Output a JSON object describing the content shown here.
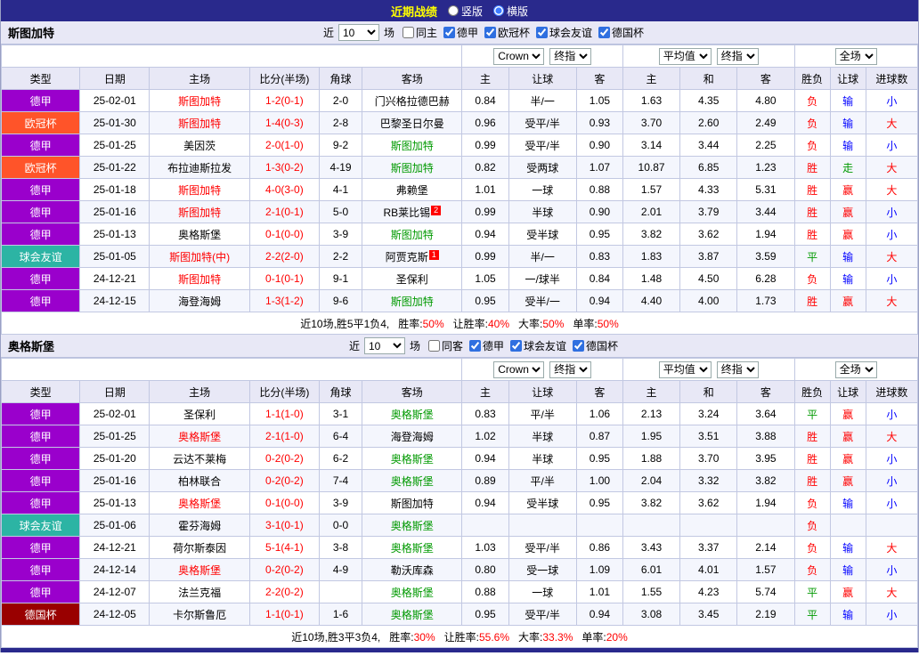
{
  "topbar": {
    "title": "近期战绩",
    "options": [
      {
        "label": "竖版",
        "selected": false
      },
      {
        "label": "横版",
        "selected": true
      }
    ]
  },
  "league_colors": {
    "德甲": "#9a00cc",
    "欧冠杯": "#ff5429",
    "球会友谊": "#2cb4a4",
    "德国杯": "#990000"
  },
  "text_colors": {
    "red": "#ff0000",
    "green": "#009900",
    "blue": "#0000ff",
    "black": "#000000"
  },
  "columns": [
    "类型",
    "日期",
    "主场",
    "比分(半场)",
    "角球",
    "客场",
    "主",
    "让球",
    "客",
    "主",
    "和",
    "客",
    "胜负",
    "让球",
    "进球数"
  ],
  "sections": [
    {
      "team": "斯图加特",
      "filter": {
        "near_label": "近",
        "count": "10",
        "unit_label": "场",
        "checkboxes": [
          {
            "label": "同主",
            "checked": false
          },
          {
            "label": "德甲",
            "checked": true
          },
          {
            "label": "欧冠杯",
            "checked": true
          },
          {
            "label": "球会友谊",
            "checked": true
          },
          {
            "label": "德国杯",
            "checked": true
          }
        ]
      },
      "selects": {
        "odds_source": "Crown",
        "odds_time": "终指",
        "europe_source": "平均值",
        "europe_time": "终指",
        "scope": "全场"
      },
      "rows": [
        {
          "league": "德甲",
          "date": "25-02-01",
          "home": {
            "text": "斯图加特",
            "color": "red"
          },
          "score": "1-2(0-1)",
          "corner": "2-0",
          "away": {
            "text": "门兴格拉德巴赫",
            "color": "black",
            "badge": ""
          },
          "asia": [
            "0.84",
            "半/一",
            "1.05"
          ],
          "europe": [
            "1.63",
            "4.35",
            "4.80"
          ],
          "result": {
            "text": "负",
            "color": "red"
          },
          "handicap": {
            "text": "输",
            "color": "blue"
          },
          "goals": {
            "text": "小",
            "color": "blue"
          }
        },
        {
          "league": "欧冠杯",
          "date": "25-01-30",
          "home": {
            "text": "斯图加特",
            "color": "red"
          },
          "score": "1-4(0-3)",
          "corner": "2-8",
          "away": {
            "text": "巴黎圣日尔曼",
            "color": "black",
            "badge": ""
          },
          "asia": [
            "0.96",
            "受平/半",
            "0.93"
          ],
          "europe": [
            "3.70",
            "2.60",
            "2.49"
          ],
          "result": {
            "text": "负",
            "color": "red"
          },
          "handicap": {
            "text": "输",
            "color": "blue"
          },
          "goals": {
            "text": "大",
            "color": "red"
          }
        },
        {
          "league": "德甲",
          "date": "25-01-25",
          "home": {
            "text": "美因茨",
            "color": "black"
          },
          "score": "2-0(1-0)",
          "corner": "9-2",
          "away": {
            "text": "斯图加特",
            "color": "green",
            "badge": ""
          },
          "asia": [
            "0.99",
            "受平/半",
            "0.90"
          ],
          "europe": [
            "3.14",
            "3.44",
            "2.25"
          ],
          "result": {
            "text": "负",
            "color": "red"
          },
          "handicap": {
            "text": "输",
            "color": "blue"
          },
          "goals": {
            "text": "小",
            "color": "blue"
          }
        },
        {
          "league": "欧冠杯",
          "date": "25-01-22",
          "home": {
            "text": "布拉迪斯拉发",
            "color": "black"
          },
          "score": "1-3(0-2)",
          "corner": "4-19",
          "away": {
            "text": "斯图加特",
            "color": "green",
            "badge": ""
          },
          "asia": [
            "0.82",
            "受两球",
            "1.07"
          ],
          "europe": [
            "10.87",
            "6.85",
            "1.23"
          ],
          "result": {
            "text": "胜",
            "color": "red"
          },
          "handicap": {
            "text": "走",
            "color": "green"
          },
          "goals": {
            "text": "大",
            "color": "red"
          }
        },
        {
          "league": "德甲",
          "date": "25-01-18",
          "home": {
            "text": "斯图加特",
            "color": "red"
          },
          "score": "4-0(3-0)",
          "corner": "4-1",
          "away": {
            "text": "弗赖堡",
            "color": "black",
            "badge": ""
          },
          "asia": [
            "1.01",
            "一球",
            "0.88"
          ],
          "europe": [
            "1.57",
            "4.33",
            "5.31"
          ],
          "result": {
            "text": "胜",
            "color": "red"
          },
          "handicap": {
            "text": "赢",
            "color": "red"
          },
          "goals": {
            "text": "大",
            "color": "red"
          }
        },
        {
          "league": "德甲",
          "date": "25-01-16",
          "home": {
            "text": "斯图加特",
            "color": "red"
          },
          "score": "2-1(0-1)",
          "corner": "5-0",
          "away": {
            "text": "RB莱比锡",
            "color": "black",
            "badge": "2"
          },
          "asia": [
            "0.99",
            "半球",
            "0.90"
          ],
          "europe": [
            "2.01",
            "3.79",
            "3.44"
          ],
          "result": {
            "text": "胜",
            "color": "red"
          },
          "handicap": {
            "text": "赢",
            "color": "red"
          },
          "goals": {
            "text": "小",
            "color": "blue"
          }
        },
        {
          "league": "德甲",
          "date": "25-01-13",
          "home": {
            "text": "奥格斯堡",
            "color": "black"
          },
          "score": "0-1(0-0)",
          "corner": "3-9",
          "away": {
            "text": "斯图加特",
            "color": "green",
            "badge": ""
          },
          "asia": [
            "0.94",
            "受半球",
            "0.95"
          ],
          "europe": [
            "3.82",
            "3.62",
            "1.94"
          ],
          "result": {
            "text": "胜",
            "color": "red"
          },
          "handicap": {
            "text": "赢",
            "color": "red"
          },
          "goals": {
            "text": "小",
            "color": "blue"
          }
        },
        {
          "league": "球会友谊",
          "date": "25-01-05",
          "home": {
            "text": "斯图加特(中)",
            "color": "red"
          },
          "score": "2-2(2-0)",
          "corner": "2-2",
          "away": {
            "text": "阿贾克斯",
            "color": "black",
            "badge": "1"
          },
          "asia": [
            "0.99",
            "半/一",
            "0.83"
          ],
          "europe": [
            "1.83",
            "3.87",
            "3.59"
          ],
          "result": {
            "text": "平",
            "color": "green"
          },
          "handicap": {
            "text": "输",
            "color": "blue"
          },
          "goals": {
            "text": "大",
            "color": "red"
          }
        },
        {
          "league": "德甲",
          "date": "24-12-21",
          "home": {
            "text": "斯图加特",
            "color": "red"
          },
          "score": "0-1(0-1)",
          "corner": "9-1",
          "away": {
            "text": "圣保利",
            "color": "black",
            "badge": ""
          },
          "asia": [
            "1.05",
            "一/球半",
            "0.84"
          ],
          "europe": [
            "1.48",
            "4.50",
            "6.28"
          ],
          "result": {
            "text": "负",
            "color": "red"
          },
          "handicap": {
            "text": "输",
            "color": "blue"
          },
          "goals": {
            "text": "小",
            "color": "blue"
          }
        },
        {
          "league": "德甲",
          "date": "24-12-15",
          "home": {
            "text": "海登海姆",
            "color": "black"
          },
          "score": "1-3(1-2)",
          "corner": "9-6",
          "away": {
            "text": "斯图加特",
            "color": "green",
            "badge": ""
          },
          "asia": [
            "0.95",
            "受半/一",
            "0.94"
          ],
          "europe": [
            "4.40",
            "4.00",
            "1.73"
          ],
          "result": {
            "text": "胜",
            "color": "red"
          },
          "handicap": {
            "text": "赢",
            "color": "red"
          },
          "goals": {
            "text": "大",
            "color": "red"
          }
        }
      ],
      "summary": {
        "prefix": "近10场,胜5平1负4,",
        "items": [
          {
            "label": "胜率:",
            "value": "50%"
          },
          {
            "label": "让胜率:",
            "value": "40%"
          },
          {
            "label": "大率:",
            "value": "50%"
          },
          {
            "label": "单率:",
            "value": "50%"
          }
        ]
      }
    },
    {
      "team": "奥格斯堡",
      "filter": {
        "near_label": "近",
        "count": "10",
        "unit_label": "场",
        "checkboxes": [
          {
            "label": "同客",
            "checked": false
          },
          {
            "label": "德甲",
            "checked": true
          },
          {
            "label": "球会友谊",
            "checked": true
          },
          {
            "label": "德国杯",
            "checked": true
          }
        ]
      },
      "selects": {
        "odds_source": "Crown",
        "odds_time": "终指",
        "europe_source": "平均值",
        "europe_time": "终指",
        "scope": "全场"
      },
      "rows": [
        {
          "league": "德甲",
          "date": "25-02-01",
          "home": {
            "text": "圣保利",
            "color": "black"
          },
          "score": "1-1(1-0)",
          "corner": "3-1",
          "away": {
            "text": "奥格斯堡",
            "color": "green",
            "badge": ""
          },
          "asia": [
            "0.83",
            "平/半",
            "1.06"
          ],
          "europe": [
            "2.13",
            "3.24",
            "3.64"
          ],
          "result": {
            "text": "平",
            "color": "green"
          },
          "handicap": {
            "text": "赢",
            "color": "red"
          },
          "goals": {
            "text": "小",
            "color": "blue"
          }
        },
        {
          "league": "德甲",
          "date": "25-01-25",
          "home": {
            "text": "奥格斯堡",
            "color": "red"
          },
          "score": "2-1(1-0)",
          "corner": "6-4",
          "away": {
            "text": "海登海姆",
            "color": "black",
            "badge": ""
          },
          "asia": [
            "1.02",
            "半球",
            "0.87"
          ],
          "europe": [
            "1.95",
            "3.51",
            "3.88"
          ],
          "result": {
            "text": "胜",
            "color": "red"
          },
          "handicap": {
            "text": "赢",
            "color": "red"
          },
          "goals": {
            "text": "大",
            "color": "red"
          }
        },
        {
          "league": "德甲",
          "date": "25-01-20",
          "home": {
            "text": "云达不莱梅",
            "color": "black"
          },
          "score": "0-2(0-2)",
          "corner": "6-2",
          "away": {
            "text": "奥格斯堡",
            "color": "green",
            "badge": ""
          },
          "asia": [
            "0.94",
            "半球",
            "0.95"
          ],
          "europe": [
            "1.88",
            "3.70",
            "3.95"
          ],
          "result": {
            "text": "胜",
            "color": "red"
          },
          "handicap": {
            "text": "赢",
            "color": "red"
          },
          "goals": {
            "text": "小",
            "color": "blue"
          }
        },
        {
          "league": "德甲",
          "date": "25-01-16",
          "home": {
            "text": "柏林联合",
            "color": "black"
          },
          "score": "0-2(0-2)",
          "corner": "7-4",
          "away": {
            "text": "奥格斯堡",
            "color": "green",
            "badge": ""
          },
          "asia": [
            "0.89",
            "平/半",
            "1.00"
          ],
          "europe": [
            "2.04",
            "3.32",
            "3.82"
          ],
          "result": {
            "text": "胜",
            "color": "red"
          },
          "handicap": {
            "text": "赢",
            "color": "red"
          },
          "goals": {
            "text": "小",
            "color": "blue"
          }
        },
        {
          "league": "德甲",
          "date": "25-01-13",
          "home": {
            "text": "奥格斯堡",
            "color": "red"
          },
          "score": "0-1(0-0)",
          "corner": "3-9",
          "away": {
            "text": "斯图加特",
            "color": "black",
            "badge": ""
          },
          "asia": [
            "0.94",
            "受半球",
            "0.95"
          ],
          "europe": [
            "3.82",
            "3.62",
            "1.94"
          ],
          "result": {
            "text": "负",
            "color": "red"
          },
          "handicap": {
            "text": "输",
            "color": "blue"
          },
          "goals": {
            "text": "小",
            "color": "blue"
          }
        },
        {
          "league": "球会友谊",
          "date": "25-01-06",
          "home": {
            "text": "霍芬海姆",
            "color": "black"
          },
          "score": "3-1(0-1)",
          "corner": "0-0",
          "away": {
            "text": "奥格斯堡",
            "color": "green",
            "badge": ""
          },
          "asia": [
            "",
            "",
            ""
          ],
          "europe": [
            "",
            "",
            ""
          ],
          "result": {
            "text": "负",
            "color": "red"
          },
          "handicap": {
            "text": "",
            "color": "black"
          },
          "goals": {
            "text": "",
            "color": "black"
          }
        },
        {
          "league": "德甲",
          "date": "24-12-21",
          "home": {
            "text": "荷尔斯泰因",
            "color": "black"
          },
          "score": "5-1(4-1)",
          "corner": "3-8",
          "away": {
            "text": "奥格斯堡",
            "color": "green",
            "badge": ""
          },
          "asia": [
            "1.03",
            "受平/半",
            "0.86"
          ],
          "europe": [
            "3.43",
            "3.37",
            "2.14"
          ],
          "result": {
            "text": "负",
            "color": "red"
          },
          "handicap": {
            "text": "输",
            "color": "blue"
          },
          "goals": {
            "text": "大",
            "color": "red"
          }
        },
        {
          "league": "德甲",
          "date": "24-12-14",
          "home": {
            "text": "奥格斯堡",
            "color": "red"
          },
          "score": "0-2(0-2)",
          "corner": "4-9",
          "away": {
            "text": "勒沃库森",
            "color": "black",
            "badge": ""
          },
          "asia": [
            "0.80",
            "受一球",
            "1.09"
          ],
          "europe": [
            "6.01",
            "4.01",
            "1.57"
          ],
          "result": {
            "text": "负",
            "color": "red"
          },
          "handicap": {
            "text": "输",
            "color": "blue"
          },
          "goals": {
            "text": "小",
            "color": "blue"
          }
        },
        {
          "league": "德甲",
          "date": "24-12-07",
          "home": {
            "text": "法兰克福",
            "color": "black"
          },
          "score": "2-2(0-2)",
          "corner": "",
          "away": {
            "text": "奥格斯堡",
            "color": "green",
            "badge": ""
          },
          "asia": [
            "0.88",
            "一球",
            "1.01"
          ],
          "europe": [
            "1.55",
            "4.23",
            "5.74"
          ],
          "result": {
            "text": "平",
            "color": "green"
          },
          "handicap": {
            "text": "赢",
            "color": "red"
          },
          "goals": {
            "text": "大",
            "color": "red"
          }
        },
        {
          "league": "德国杯",
          "date": "24-12-05",
          "home": {
            "text": "卡尔斯鲁厄",
            "color": "black"
          },
          "score": "1-1(0-1)",
          "corner": "1-6",
          "away": {
            "text": "奥格斯堡",
            "color": "green",
            "badge": ""
          },
          "asia": [
            "0.95",
            "受平/半",
            "0.94"
          ],
          "europe": [
            "3.08",
            "3.45",
            "2.19"
          ],
          "result": {
            "text": "平",
            "color": "green"
          },
          "handicap": {
            "text": "输",
            "color": "blue"
          },
          "goals": {
            "text": "小",
            "color": "blue"
          }
        }
      ],
      "summary": {
        "prefix": "近10场,胜3平3负4,",
        "items": [
          {
            "label": "胜率:",
            "value": "30%"
          },
          {
            "label": "让胜率:",
            "value": "55.6%"
          },
          {
            "label": "大率:",
            "value": "33.3%"
          },
          {
            "label": "单率:",
            "value": "20%"
          }
        ]
      }
    }
  ]
}
